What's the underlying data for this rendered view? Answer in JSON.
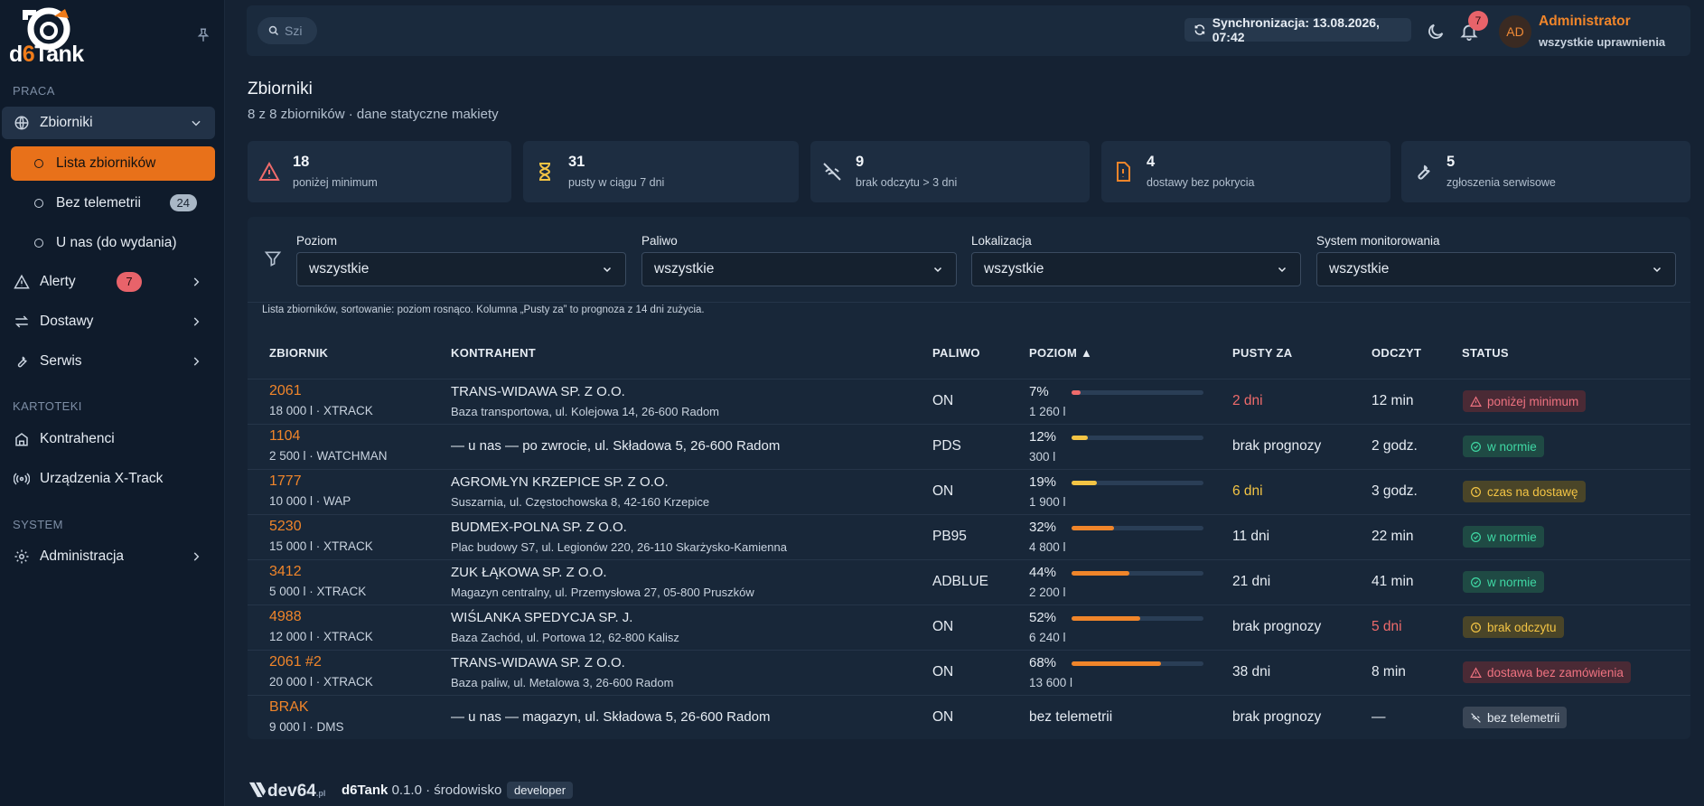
{
  "brand": {
    "name_prefix": "d",
    "name_six": "6",
    "name_suffix": "Tank"
  },
  "sidebar": {
    "section_work": "PRACA",
    "section_files": "KARTOTEKI",
    "section_system": "SYSTEM",
    "tanks": "Zbiorniki",
    "tank_list": "Lista zbiorników",
    "no_telemetry": "Bez telemetrii",
    "no_telemetry_count": "24",
    "at_us": "U nas (do wydania)",
    "alerts": "Alerty",
    "alerts_count": "7",
    "deliveries": "Dostawy",
    "service": "Serwis",
    "contractors": "Kontrahenci",
    "devices": "Urządzenia X-Track",
    "admin": "Administracja"
  },
  "topbar": {
    "search_placeholder": "Szi",
    "sync": "Synchronizacja: 13.08.2026, 07:42",
    "notifications_count": "7",
    "avatar": "AD",
    "user_name": "Administrator",
    "user_role": "wszystkie uprawnienia"
  },
  "page": {
    "title": "Zbiorniki",
    "subtitle": "8 z 8 zbiorników · dane statyczne makiety"
  },
  "stats": [
    {
      "value": "18",
      "label": "poniżej minimum",
      "icon": "warning-icon",
      "color": "#ef6b6b"
    },
    {
      "value": "31",
      "label": "pusty w ciągu 7 dni",
      "icon": "hourglass-icon",
      "color": "#f3c444"
    },
    {
      "value": "9",
      "label": "brak odczytu > 3 dni",
      "icon": "wifi-off-icon",
      "color": "#c9d3df"
    },
    {
      "value": "4",
      "label": "dostawy bez pokrycia",
      "icon": "file-alert-icon",
      "color": "#f0852a"
    },
    {
      "value": "5",
      "label": "zgłoszenia serwisowe",
      "icon": "wrench-icon",
      "color": "#c9d3df"
    }
  ],
  "filters": {
    "level_label": "Poziom",
    "level_value": "wszystkie",
    "fuel_label": "Paliwo",
    "fuel_value": "wszystkie",
    "location_label": "Lokalizacja",
    "location_value": "wszystkie",
    "system_label": "System monitorowania",
    "system_value": "wszystkie"
  },
  "table": {
    "note": "Lista zbiorników, sortowanie: poziom rosnąco. Kolumna „Pusty za” to prognoza z 14 dni zużycia.",
    "headers": [
      "ZBIORNIK",
      "KONTRAHENT",
      "PALIWO",
      "POZIOM ▲",
      "PUSTY ZA",
      "ODCZYT",
      "STATUS"
    ],
    "rows": [
      {
        "id": "2061",
        "sub": "18 000 l · XTRACK",
        "client": "TRANS-WIDAWA SP. Z O.O.",
        "addr": "Baza transportowa, ul. Kolejowa 14, 26-600 Radom",
        "fuel": "ON",
        "pct": "7%",
        "level": 7,
        "vol": "1 260 l",
        "empty": "2 dni",
        "empty_color": "#ef6b6b",
        "read": "12 min",
        "read_color": "#e6ecf3",
        "status": "poniżej minimum",
        "st": "red"
      },
      {
        "id": "1104",
        "sub": "2 500 l · WATCHMAN",
        "client": "",
        "addr": "— u nas — po zwrocie, ul. Składowa 5, 26-600 Radom",
        "fuel": "PDS",
        "pct": "12%",
        "level": 12,
        "vol": "300 l",
        "empty": "brak prognozy",
        "empty_color": "#e6ecf3",
        "read": "2 godz.",
        "read_color": "#e6ecf3",
        "status": "w normie",
        "st": "green"
      },
      {
        "id": "1777",
        "sub": "10 000 l · WAP",
        "client": "AGROMŁYN KRZEPICE SP. Z O.O.",
        "addr": "Suszarnia, ul. Częstochowska 8, 42-160 Krzepice",
        "fuel": "ON",
        "pct": "19%",
        "level": 19,
        "vol": "1 900 l",
        "empty": "6 dni",
        "empty_color": "#f3c444",
        "read": "3 godz.",
        "read_color": "#e6ecf3",
        "status": "czas na dostawę",
        "st": "yellow"
      },
      {
        "id": "5230",
        "sub": "15 000 l · XTRACK",
        "client": "BUDMEX-POLNA SP. Z O.O.",
        "addr": "Plac budowy S7, ul. Legionów 220, 26-110 Skarżysko-Kamienna",
        "fuel": "PB95",
        "pct": "32%",
        "level": 32,
        "vol": "4 800 l",
        "empty": "11 dni",
        "empty_color": "#e6ecf3",
        "read": "22 min",
        "read_color": "#e6ecf3",
        "status": "w normie",
        "st": "green"
      },
      {
        "id": "3412",
        "sub": "5 000 l · XTRACK",
        "client": "ZUK ŁĄKOWA SP. Z O.O.",
        "addr": "Magazyn centralny, ul. Przemysłowa 27, 05-800 Pruszków",
        "fuel": "ADBLUE",
        "pct": "44%",
        "level": 44,
        "vol": "2 200 l",
        "empty": "21 dni",
        "empty_color": "#e6ecf3",
        "read": "41 min",
        "read_color": "#e6ecf3",
        "status": "w normie",
        "st": "green"
      },
      {
        "id": "4988",
        "sub": "12 000 l · XTRACK",
        "client": "WIŚLANKA SPEDYCJA SP. J.",
        "addr": "Baza Zachód, ul. Portowa 12, 62-800 Kalisz",
        "fuel": "ON",
        "pct": "52%",
        "level": 52,
        "vol": "6 240 l",
        "empty": "brak prognozy",
        "empty_color": "#e6ecf3",
        "read": "5 dni",
        "read_color": "#ef6b6b",
        "status": "brak odczytu",
        "st": "yellow"
      },
      {
        "id": "2061 #2",
        "sub": "20 000 l · XTRACK",
        "client": "TRANS-WIDAWA SP. Z O.O.",
        "addr": "Baza paliw, ul. Metalowa 3, 26-600 Radom",
        "fuel": "ON",
        "pct": "68%",
        "level": 68,
        "vol": "13 600 l",
        "empty": "38 dni",
        "empty_color": "#e6ecf3",
        "read": "8 min",
        "read_color": "#e6ecf3",
        "status": "dostawa bez zamówienia",
        "st": "red"
      },
      {
        "id": "BRAK",
        "sub": "9 000 l · DMS",
        "client": "",
        "addr": "— u nas — magazyn, ul. Składowa 5, 26-600 Radom",
        "fuel": "ON",
        "pct": "bez telemetrii",
        "level": null,
        "vol": "",
        "empty": "brak prognozy",
        "empty_color": "#e6ecf3",
        "read": "—",
        "read_color": "#e6ecf3",
        "status": "bez telemetrii",
        "st": "gray"
      }
    ]
  },
  "footer": {
    "logo": "dev64",
    "logo_small": ".pl",
    "app": "d6Tank",
    "version": "0.1.0 · środowisko",
    "env": "developer"
  },
  "colors": {
    "accent": "#e8711a",
    "red": "#ef6b6b",
    "yellow": "#f3c444",
    "green": "#3fd8a4"
  }
}
